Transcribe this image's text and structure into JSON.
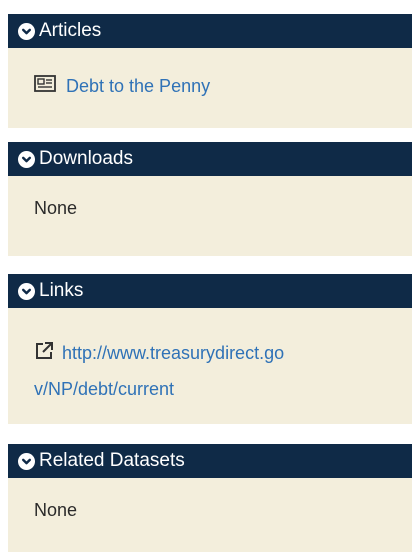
{
  "sections": {
    "articles": {
      "title": "Articles",
      "item_label": "Debt to the Penny",
      "item_icon": "newspaper-icon"
    },
    "downloads": {
      "title": "Downloads",
      "empty_text": "None"
    },
    "links": {
      "title": "Links",
      "url_line1": "http://www.treasurydirect.go",
      "url_line2": "v/NP/debt/current",
      "item_icon": "external-link-icon"
    },
    "related": {
      "title": "Related Datasets",
      "empty_text": "None"
    }
  },
  "colors": {
    "header_bg": "#0f2a47",
    "body_bg": "#f3eedc",
    "link": "#2f72b7"
  }
}
